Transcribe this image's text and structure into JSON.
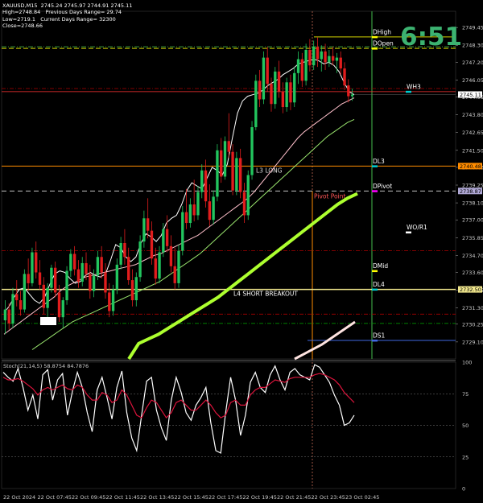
{
  "header": {
    "symbol": "XAUUSD,M15",
    "ohlc": "2745.24 2745.97 2744.91 2745.11",
    "high_line": "High=2748.84   Previous Days Range= 29.74",
    "low_line": "Low=2719.1   Current Days Range= 32300",
    "close_line": "Close=2748.66"
  },
  "clock": "6:51",
  "colors": {
    "background": "#000000",
    "bull": "#22c55e",
    "bear": "#e11d1d",
    "ma_fast": "#ffffff",
    "ma_pink": "#ffc0cb",
    "ma_green": "#9ae66e",
    "ma_thick": "#adff2f",
    "level_gold": "#f0e68c",
    "level_orange": "#ff8c00",
    "level_red": "#dc143c",
    "accent_cyan": "#00ced1"
  },
  "chart_data": [
    {
      "type": "candlestick",
      "title": "XAUUSD,M15",
      "x": [
        "22 Oct 2024",
        "22 Oct 07:45",
        "22 Oct 09:45",
        "22 Oct 11:45",
        "22 Oct 13:45",
        "22 Oct 15:45",
        "22 Oct 17:45",
        "22 Oct 19:45",
        "22 Oct 21:45",
        "22 Oct 23:45",
        "23 Oct 02:45"
      ],
      "ylim": [
        2728.0,
        2750.5
      ],
      "y_ticks": [
        "2749.45",
        "2748.30",
        "2747.20",
        "2746.05",
        "2744.95",
        "2743.80",
        "2742.65",
        "2741.50",
        "2740.40",
        "2739.25",
        "2738.10",
        "2737.00",
        "2735.85",
        "2734.70",
        "2733.60",
        "2732.45",
        "2731.30",
        "2730.25",
        "2729.10"
      ],
      "last_price": "2745.11",
      "levels": [
        {
          "name": "DHigh",
          "price": 2748.84,
          "tag": ""
        },
        {
          "name": "DOpen",
          "price": 2748.1,
          "tag": ""
        },
        {
          "name": "WH3",
          "price": 2745.3,
          "tag": ""
        },
        {
          "name": "L3 LONG",
          "price": 2740.48,
          "tag": "2740.48"
        },
        {
          "name": "DL3",
          "price": 2740.48,
          "tag": ""
        },
        {
          "name": "DPivot",
          "price": 2738.87,
          "tag": "2738.87"
        },
        {
          "name": "Pivot Point",
          "price": 2738.87,
          "tag": ""
        },
        {
          "name": "WO/R1",
          "price": 2736.2,
          "tag": ""
        },
        {
          "name": "DMid",
          "price": 2733.7,
          "tag": ""
        },
        {
          "name": "L4 SHORT BREAKOUT",
          "price": 2732.5,
          "tag": "2732.50"
        },
        {
          "name": "DL4",
          "price": 2732.5,
          "tag": ""
        },
        {
          "name": "DS1",
          "price": 2729.2,
          "tag": ""
        }
      ],
      "ohlc": [
        [
          2730.5,
          2731.8,
          2729.6,
          2731.2
        ],
        [
          2731.2,
          2731.6,
          2729.9,
          2730.3
        ],
        [
          2730.3,
          2732.6,
          2730.0,
          2732.2
        ],
        [
          2732.2,
          2733.1,
          2731.4,
          2731.8
        ],
        [
          2731.8,
          2732.4,
          2730.8,
          2731.2
        ],
        [
          2731.2,
          2733.8,
          2731.0,
          2733.5
        ],
        [
          2733.5,
          2734.5,
          2732.4,
          2732.9
        ],
        [
          2732.9,
          2735.2,
          2732.7,
          2734.9
        ],
        [
          2734.9,
          2735.6,
          2733.2,
          2733.6
        ],
        [
          2733.6,
          2734.4,
          2732.5,
          2732.8
        ],
        [
          2732.8,
          2733.3,
          2730.9,
          2731.3
        ],
        [
          2731.3,
          2732.9,
          2730.6,
          2732.6
        ],
        [
          2732.6,
          2734.1,
          2732.3,
          2733.9
        ],
        [
          2733.9,
          2734.3,
          2732.0,
          2732.3
        ],
        [
          2732.3,
          2732.8,
          2730.4,
          2730.7
        ],
        [
          2730.7,
          2732.0,
          2730.0,
          2731.8
        ],
        [
          2731.8,
          2734.0,
          2731.5,
          2733.7
        ],
        [
          2733.7,
          2735.1,
          2733.3,
          2734.8
        ],
        [
          2734.8,
          2735.3,
          2733.4,
          2733.8
        ],
        [
          2733.8,
          2734.4,
          2732.6,
          2733.0
        ],
        [
          2733.0,
          2734.6,
          2732.7,
          2734.2
        ],
        [
          2734.2,
          2734.9,
          2733.1,
          2733.5
        ],
        [
          2733.5,
          2734.1,
          2731.9,
          2732.4
        ],
        [
          2732.4,
          2733.8,
          2732.0,
          2733.4
        ],
        [
          2733.4,
          2735.0,
          2733.1,
          2734.6
        ],
        [
          2734.6,
          2735.3,
          2733.2,
          2733.6
        ],
        [
          2733.6,
          2734.2,
          2731.9,
          2732.3
        ],
        [
          2732.3,
          2732.9,
          2730.7,
          2731.1
        ],
        [
          2731.1,
          2732.8,
          2730.8,
          2732.5
        ],
        [
          2732.5,
          2734.5,
          2732.2,
          2734.1
        ],
        [
          2734.1,
          2735.9,
          2733.8,
          2735.5
        ],
        [
          2735.5,
          2736.4,
          2734.1,
          2734.6
        ],
        [
          2734.6,
          2735.2,
          2732.8,
          2733.1
        ],
        [
          2733.1,
          2733.8,
          2731.4,
          2731.8
        ],
        [
          2731.8,
          2733.6,
          2731.4,
          2733.3
        ],
        [
          2733.3,
          2736.0,
          2733.0,
          2735.6
        ],
        [
          2735.6,
          2737.6,
          2735.2,
          2737.1
        ],
        [
          2737.1,
          2738.4,
          2735.8,
          2736.3
        ],
        [
          2736.3,
          2736.9,
          2734.1,
          2734.5
        ],
        [
          2734.5,
          2735.2,
          2732.8,
          2733.2
        ],
        [
          2733.2,
          2735.3,
          2732.9,
          2734.9
        ],
        [
          2734.9,
          2736.8,
          2734.6,
          2736.4
        ],
        [
          2736.4,
          2737.3,
          2734.9,
          2735.3
        ],
        [
          2735.3,
          2736.0,
          2733.6,
          2734.0
        ],
        [
          2734.0,
          2735.2,
          2732.5,
          2732.9
        ],
        [
          2732.9,
          2735.4,
          2732.6,
          2735.0
        ],
        [
          2735.0,
          2737.9,
          2734.7,
          2737.5
        ],
        [
          2737.5,
          2739.0,
          2736.4,
          2736.8
        ],
        [
          2736.8,
          2738.4,
          2736.5,
          2738.0
        ],
        [
          2738.0,
          2739.6,
          2736.9,
          2737.3
        ],
        [
          2737.3,
          2739.2,
          2737.0,
          2738.8
        ],
        [
          2738.8,
          2740.6,
          2738.4,
          2740.2
        ],
        [
          2740.2,
          2740.9,
          2737.8,
          2738.2
        ],
        [
          2738.2,
          2739.3,
          2736.6,
          2737.0
        ],
        [
          2737.0,
          2738.9,
          2736.7,
          2738.5
        ],
        [
          2738.5,
          2741.9,
          2738.2,
          2741.5
        ],
        [
          2741.5,
          2742.3,
          2739.4,
          2739.8
        ],
        [
          2739.8,
          2742.4,
          2739.6,
          2742.1
        ],
        [
          2742.1,
          2743.9,
          2741.0,
          2741.4
        ],
        [
          2741.4,
          2741.9,
          2738.6,
          2738.9
        ],
        [
          2738.9,
          2741.4,
          2738.6,
          2741.0
        ],
        [
          2741.0,
          2741.6,
          2738.4,
          2738.8
        ],
        [
          2738.8,
          2739.4,
          2736.8,
          2737.3
        ],
        [
          2737.3,
          2740.2,
          2737.0,
          2739.9
        ],
        [
          2739.9,
          2743.4,
          2739.6,
          2743.0
        ],
        [
          2743.0,
          2746.4,
          2742.8,
          2746.0
        ],
        [
          2746.0,
          2746.7,
          2744.3,
          2744.8
        ],
        [
          2744.8,
          2747.9,
          2744.5,
          2747.5
        ],
        [
          2747.5,
          2748.2,
          2745.3,
          2745.8
        ],
        [
          2745.8,
          2746.2,
          2744.0,
          2744.5
        ],
        [
          2744.5,
          2746.9,
          2744.2,
          2746.6
        ],
        [
          2746.6,
          2747.3,
          2744.9,
          2745.3
        ],
        [
          2745.3,
          2745.9,
          2743.9,
          2744.3
        ],
        [
          2744.3,
          2746.2,
          2744.0,
          2745.9
        ],
        [
          2745.9,
          2746.4,
          2744.1,
          2744.6
        ],
        [
          2744.6,
          2746.9,
          2744.3,
          2746.5
        ],
        [
          2746.5,
          2747.9,
          2745.8,
          2747.4
        ],
        [
          2747.4,
          2747.8,
          2745.6,
          2746.0
        ],
        [
          2746.0,
          2748.4,
          2745.7,
          2748.0
        ],
        [
          2748.0,
          2748.7,
          2746.6,
          2747.0
        ],
        [
          2747.0,
          2748.6,
          2746.7,
          2748.2
        ],
        [
          2748.2,
          2748.8,
          2746.9,
          2747.4
        ],
        [
          2747.4,
          2748.3,
          2746.6,
          2747.9
        ],
        [
          2747.9,
          2748.4,
          2746.7,
          2747.2
        ],
        [
          2747.2,
          2748.0,
          2746.9,
          2747.6
        ],
        [
          2747.6,
          2748.2,
          2747.0,
          2747.3
        ],
        [
          2747.3,
          2747.8,
          2746.5,
          2747.5
        ],
        [
          2747.5,
          2747.9,
          2746.4,
          2746.8
        ],
        [
          2746.8,
          2747.2,
          2745.4,
          2745.7
        ],
        [
          2745.7,
          2746.1,
          2744.6,
          2745.0
        ],
        [
          2745.0,
          2745.5,
          2744.7,
          2745.11
        ]
      ],
      "lines": [
        {
          "color": "#ffffff",
          "values": [
            2731.0,
            2731.4,
            2732.0,
            2732.5,
            2732.6,
            2732.2,
            2731.8,
            2731.6,
            2732.0,
            2732.8,
            2733.5,
            2733.7,
            2733.6,
            2733.2,
            2732.9,
            2733.0,
            2733.4,
            2733.6,
            2733.4,
            2733.3,
            2733.5,
            2734.4,
            2735.4,
            2735.2,
            2734.6,
            2734.3,
            2734.6,
            2735.5,
            2736.1,
            2735.9,
            2735.6,
            2736.0,
            2736.8,
            2737.1,
            2737.3,
            2738.0,
            2738.9,
            2739.4,
            2739.2,
            2739.0,
            2739.7,
            2740.4,
            2740.2,
            2739.9,
            2740.6,
            2742.3,
            2743.9,
            2744.7,
            2745.0,
            2745.1,
            2745.2,
            2745.4,
            2745.7,
            2745.9,
            2746.1,
            2746.4,
            2746.6,
            2746.8,
            2747.1,
            2747.2,
            2747.3,
            2747.4,
            2747.3,
            2747.1,
            2747.2,
            2747.0,
            2746.6,
            2745.9,
            2745.3,
            2745.1
          ]
        },
        {
          "color": "#ffc0cb",
          "values": [
            2729.6,
            2729.9,
            2730.2,
            2730.5,
            2730.8,
            2731.1,
            2731.4,
            2731.7,
            2732.0,
            2732.4,
            2732.7,
            2732.9,
            2733.1,
            2733.3,
            2733.4,
            2733.5,
            2733.6,
            2733.7,
            2733.8,
            2733.9,
            2734.0,
            2734.1,
            2734.3,
            2734.5,
            2734.7,
            2734.8,
            2735.0,
            2735.2,
            2735.4,
            2735.6,
            2735.8,
            2736.0,
            2736.3,
            2736.6,
            2736.9,
            2737.2,
            2737.5,
            2737.8,
            2738.1,
            2738.4,
            2738.8,
            2739.3,
            2739.8,
            2740.3,
            2740.8,
            2741.3,
            2741.8,
            2742.3,
            2742.7,
            2743.0,
            2743.3,
            2743.6,
            2743.9,
            2744.2,
            2744.5,
            2744.7,
            2744.9
          ]
        },
        {
          "color": "#9ae66e",
          "values": [
            2728.6,
            2728.9,
            2729.2,
            2729.5,
            2729.8,
            2730.1,
            2730.4,
            2730.6,
            2730.8,
            2731.0,
            2731.2,
            2731.4,
            2731.6,
            2731.8,
            2732.0,
            2732.2,
            2732.4,
            2732.6,
            2732.8,
            2733.0,
            2733.3,
            2733.6,
            2733.9,
            2734.2,
            2734.5,
            2734.8,
            2735.2,
            2735.6,
            2736.0,
            2736.4,
            2736.8,
            2737.2,
            2737.6,
            2738.0,
            2738.4,
            2738.8,
            2739.2,
            2739.6,
            2740.0,
            2740.4,
            2740.8,
            2741.2,
            2741.6,
            2742.0,
            2742.4,
            2742.7,
            2743.0,
            2743.3,
            2743.5
          ]
        },
        {
          "color": "#adff2f",
          "values": [
            2728.0,
            2729.0,
            2729.3,
            2729.6,
            2730.0,
            2730.4,
            2730.8,
            2731.2,
            2731.6,
            2732.0,
            2732.5,
            2733.0,
            2733.5,
            2734.0,
            2734.5,
            2735.0,
            2735.5,
            2736.0,
            2736.5,
            2737.0,
            2737.5,
            2738.0,
            2738.4,
            2738.7
          ]
        }
      ]
    },
    {
      "type": "line",
      "title": "Stoch(21,14,5) 58.8754 84.7876",
      "ylim": [
        0,
        100
      ],
      "y_ticks": [
        "100",
        "75",
        "50",
        "25",
        "0"
      ],
      "series": [
        {
          "color": "#ffffff",
          "values": [
            92,
            88,
            85,
            95,
            80,
            62,
            74,
            55,
            90,
            94,
            70,
            86,
            91,
            58,
            77,
            92,
            80,
            60,
            45,
            78,
            88,
            72,
            55,
            80,
            93,
            60,
            40,
            30,
            58,
            85,
            88,
            62,
            48,
            38,
            70,
            88,
            76,
            60,
            54,
            66,
            72,
            80,
            52,
            30,
            28,
            60,
            88,
            70,
            42,
            58,
            84,
            92,
            80,
            76,
            90,
            97,
            86,
            78,
            92,
            95,
            90,
            88,
            86,
            98,
            96,
            90,
            84,
            74,
            66,
            50,
            52,
            58
          ]
        },
        {
          "color": "#dc143c",
          "values": [
            88,
            86,
            86,
            87,
            85,
            82,
            79,
            74,
            78,
            80,
            78,
            80,
            82,
            79,
            78,
            82,
            80,
            74,
            70,
            70,
            76,
            74,
            68,
            70,
            78,
            74,
            66,
            58,
            56,
            64,
            70,
            68,
            62,
            56,
            60,
            68,
            70,
            66,
            62,
            62,
            66,
            70,
            66,
            60,
            56,
            58,
            68,
            70,
            66,
            66,
            74,
            78,
            80,
            80,
            83,
            86,
            85,
            84,
            87,
            88,
            88,
            88,
            88,
            90,
            91,
            90,
            88,
            86,
            82,
            76,
            72,
            68
          ]
        }
      ]
    }
  ]
}
